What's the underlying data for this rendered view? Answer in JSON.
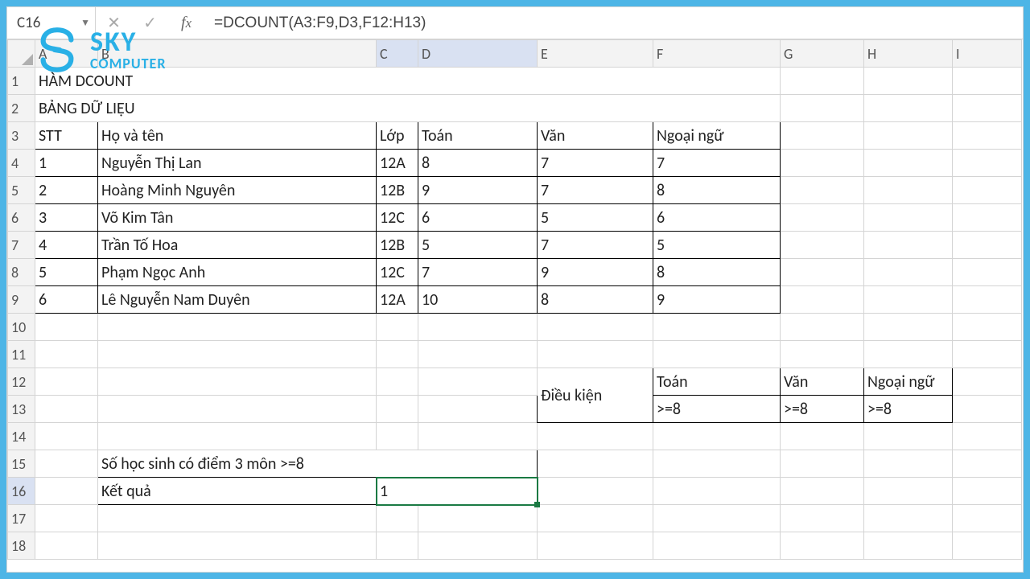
{
  "name_box": "C16",
  "formula": "=DCOUNT(A3:F9,D3,F12:H13)",
  "columns": [
    "A",
    "B",
    "C",
    "D",
    "E",
    "F",
    "G",
    "H",
    "I"
  ],
  "titles": {
    "main": "HÀM DCOUNT",
    "sub": "BẢNG DỮ LIỆU"
  },
  "headers": {
    "stt": "STT",
    "name": "Họ và tên",
    "class": "Lớp",
    "math": "Toán",
    "lit": "Văn",
    "lang": "Ngoại ngữ"
  },
  "rows": [
    {
      "stt": "1",
      "name": "Nguyễn Thị Lan",
      "class": "12A",
      "math": "8",
      "lit": "7",
      "lang": "7"
    },
    {
      "stt": "2",
      "name": "Hoàng Minh Nguyên",
      "class": "12B",
      "math": "9",
      "lit": "7",
      "lang": "8"
    },
    {
      "stt": "3",
      "name": "Võ Kim Tân",
      "class": "12C",
      "math": "6",
      "lit": "5",
      "lang": "6"
    },
    {
      "stt": "4",
      "name": "Trần Tố Hoa",
      "class": "12B",
      "math": "5",
      "lit": "7",
      "lang": "5"
    },
    {
      "stt": "5",
      "name": "Phạm Ngọc Anh",
      "class": "12C",
      "math": "7",
      "lit": "9",
      "lang": "8"
    },
    {
      "stt": "6",
      "name": "Lê Nguyễn Nam Duyên",
      "class": "12A",
      "math": "10",
      "lit": "8",
      "lang": "9"
    }
  ],
  "criteria": {
    "label": "Điều kiện",
    "h1": "Toán",
    "h2": "Văn",
    "h3": "Ngoại ngữ",
    "v1": ">=8",
    "v2": ">=8",
    "v3": ">=8"
  },
  "result_block": {
    "title": "Số học sinh có điểm 3 môn  >=8",
    "label": "Kết quả",
    "value": "1"
  },
  "logo": {
    "t1": "SKY",
    "t2": "COMPUTER"
  }
}
